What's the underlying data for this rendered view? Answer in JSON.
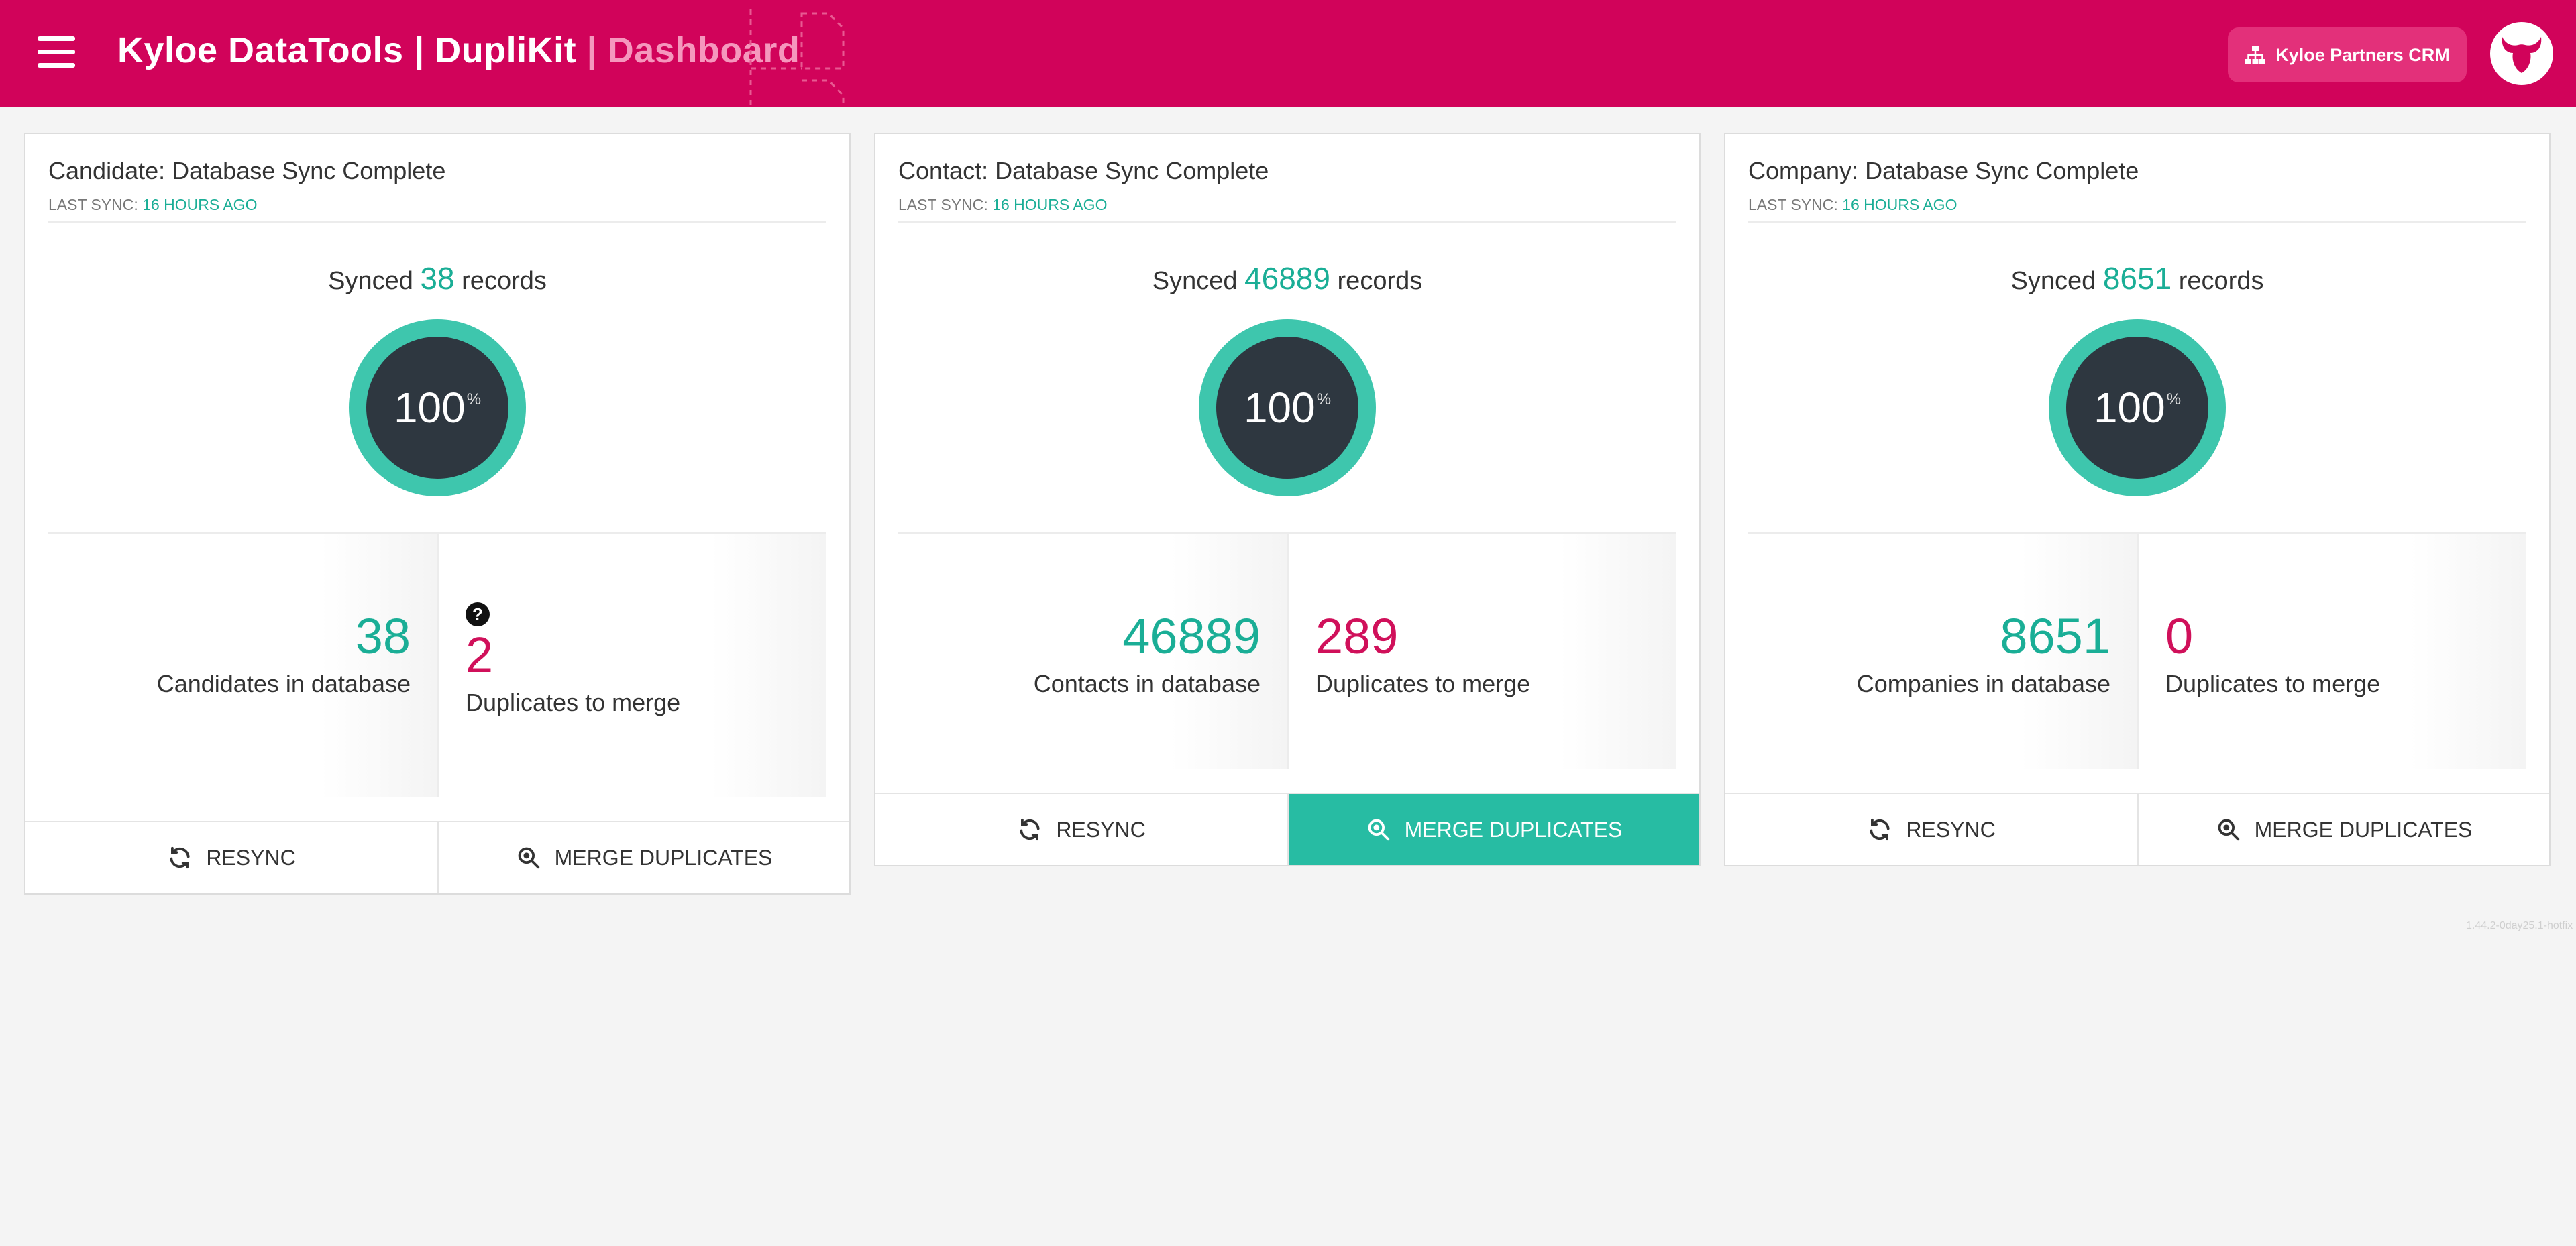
{
  "header": {
    "title_main": "Kyloe DataTools | DupliKit",
    "title_sep": " | ",
    "title_sub": "Dashboard",
    "crm_button_label": "Kyloe Partners CRM"
  },
  "cards": [
    {
      "title": "Candidate: Database Sync Complete",
      "last_sync_label": "LAST SYNC:",
      "last_sync_value": "16 HOURS AGO",
      "synced_prefix": "Synced",
      "synced_count": "38",
      "synced_suffix": "records",
      "progress_percent": "100",
      "percent_sign": "%",
      "db_count": "38",
      "db_label": "Candidates in database",
      "dup_count": "2",
      "dup_label": "Duplicates to merge",
      "resync_label": "RESYNC",
      "merge_label": "MERGE DUPLICATES"
    },
    {
      "title": "Contact: Database Sync Complete",
      "last_sync_label": "LAST SYNC:",
      "last_sync_value": "16 HOURS AGO",
      "synced_prefix": "Synced",
      "synced_count": "46889",
      "synced_suffix": "records",
      "progress_percent": "100",
      "percent_sign": "%",
      "db_count": "46889",
      "db_label": "Contacts in database",
      "dup_count": "289",
      "dup_label": "Duplicates to merge",
      "resync_label": "RESYNC",
      "merge_label": "MERGE DUPLICATES"
    },
    {
      "title": "Company: Database Sync Complete",
      "last_sync_label": "LAST SYNC:",
      "last_sync_value": "16 HOURS AGO",
      "synced_prefix": "Synced",
      "synced_count": "8651",
      "synced_suffix": "records",
      "progress_percent": "100",
      "percent_sign": "%",
      "db_count": "8651",
      "db_label": "Companies in database",
      "dup_count": "0",
      "dup_label": "Duplicates to merge",
      "resync_label": "RESYNC",
      "merge_label": "MERGE DUPLICATES"
    }
  ],
  "footer": {
    "version": "1.44.2-0day25.1-hotfix"
  },
  "icons": [
    "menu-icon",
    "sitemap-icon",
    "bull-logo-icon",
    "help-icon",
    "refresh-icon",
    "zoom-icon"
  ],
  "colors": {
    "brand": "#d1035a",
    "teal": "#1aae96",
    "dark": "#2e3740",
    "pink": "#d0105a"
  }
}
